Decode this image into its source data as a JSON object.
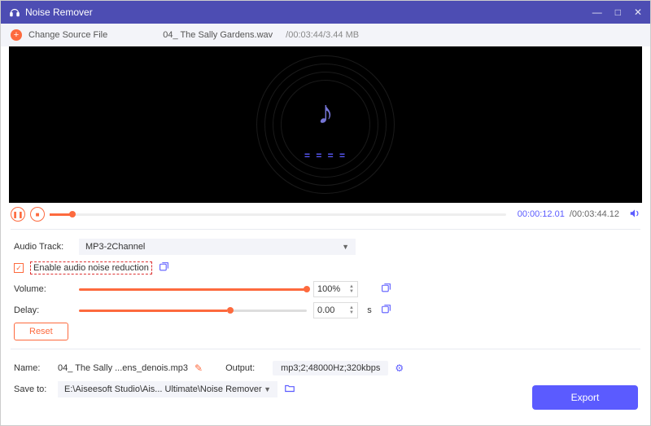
{
  "titlebar": {
    "app_name": "Noise Remover"
  },
  "sourcebar": {
    "change_label": "Change Source File",
    "file_name": "04_ The Sally Gardens.wav",
    "file_meta": "/00:03:44/3.44 MB"
  },
  "player": {
    "current_time": "00:00:12.01",
    "total_time": "/00:03:44.12"
  },
  "settings": {
    "audio_track_label": "Audio Track:",
    "audio_track_value": "MP3-2Channel",
    "enable_noise_label": "Enable audio noise reduction",
    "volume_label": "Volume:",
    "volume_value": "100%",
    "delay_label": "Delay:",
    "delay_value": "0.00",
    "delay_unit": "s",
    "reset_label": "Reset"
  },
  "footer": {
    "name_label": "Name:",
    "name_value": "04_ The Sally ...ens_denois.mp3",
    "output_label": "Output:",
    "output_value": "mp3;2;48000Hz;320kbps",
    "saveto_label": "Save to:",
    "saveto_value": "E:\\Aiseesoft Studio\\Ais... Ultimate\\Noise Remover",
    "export_label": "Export"
  },
  "visual": {
    "eq_bars": "= = = ="
  }
}
